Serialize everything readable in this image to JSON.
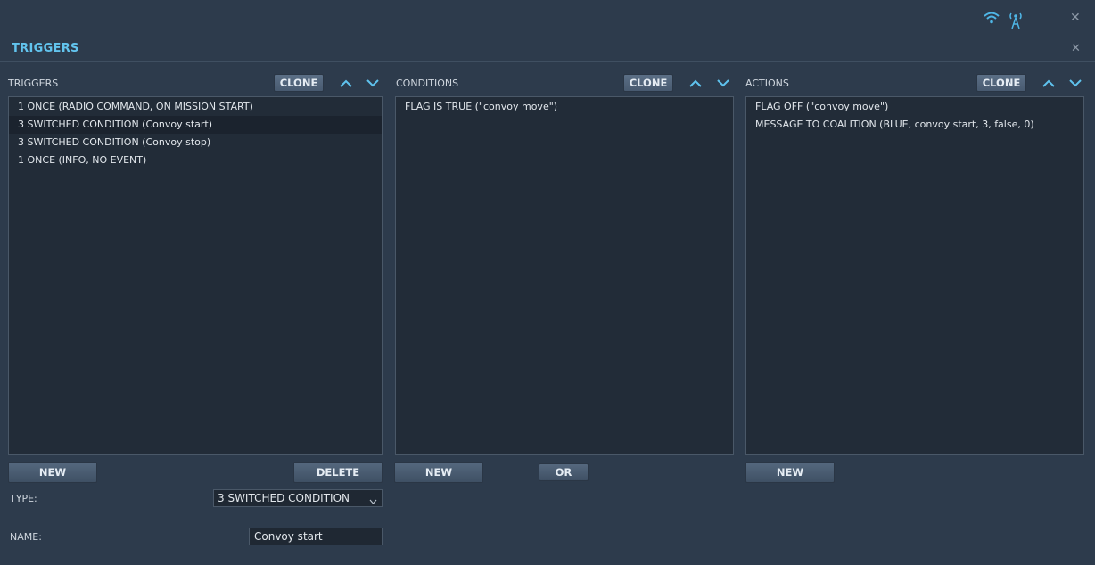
{
  "window": {
    "title": "TRIGGERS"
  },
  "status_icons": [
    "wifi-icon",
    "radio-tower-icon"
  ],
  "triggers": {
    "label": "TRIGGERS",
    "clone_label": "CLONE",
    "items": [
      "1 ONCE (RADIO COMMAND, ON MISSION START)",
      "3 SWITCHED CONDITION (Convoy start)",
      "3 SWITCHED CONDITION (Convoy stop)",
      "1 ONCE (INFO, NO EVENT)"
    ],
    "selected_index": 1,
    "new_label": "NEW",
    "delete_label": "DELETE"
  },
  "conditions": {
    "label": "CONDITIONS",
    "clone_label": "CLONE",
    "items": [
      "FLAG IS TRUE (\"convoy move\")"
    ],
    "new_label": "NEW",
    "or_label": "OR"
  },
  "actions": {
    "label": "ACTIONS",
    "clone_label": "CLONE",
    "items": [
      "FLAG OFF (\"convoy move\")",
      "MESSAGE TO COALITION (BLUE, convoy start, 3, false, 0)"
    ],
    "new_label": "NEW"
  },
  "form": {
    "type_label": "TYPE:",
    "type_value": "3 SWITCHED CONDITION",
    "name_label": "NAME:",
    "name_value": "Convoy start"
  },
  "colors": {
    "accent": "#62c4ee",
    "background": "#2d3b4c",
    "panel": "#222c38"
  }
}
